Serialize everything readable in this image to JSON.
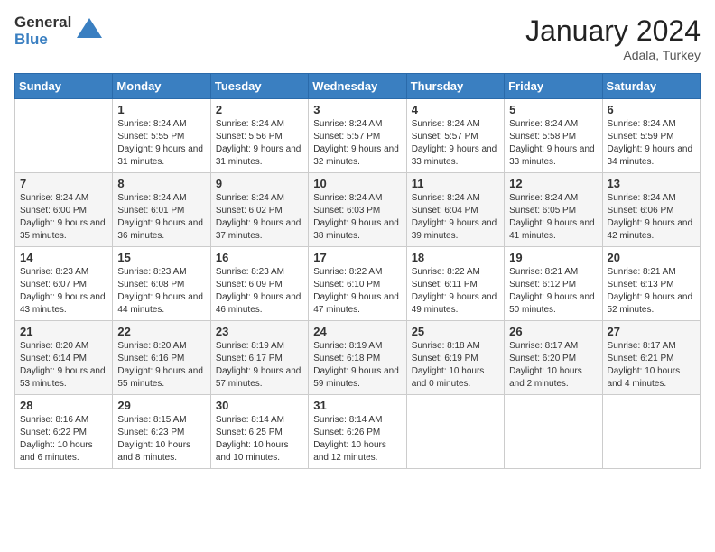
{
  "logo": {
    "general": "General",
    "blue": "Blue"
  },
  "header": {
    "month": "January 2024",
    "location": "Adala, Turkey"
  },
  "weekdays": [
    "Sunday",
    "Monday",
    "Tuesday",
    "Wednesday",
    "Thursday",
    "Friday",
    "Saturday"
  ],
  "weeks": [
    [
      {
        "day": "",
        "sunrise": "",
        "sunset": "",
        "daylight": ""
      },
      {
        "day": "1",
        "sunrise": "Sunrise: 8:24 AM",
        "sunset": "Sunset: 5:55 PM",
        "daylight": "Daylight: 9 hours and 31 minutes."
      },
      {
        "day": "2",
        "sunrise": "Sunrise: 8:24 AM",
        "sunset": "Sunset: 5:56 PM",
        "daylight": "Daylight: 9 hours and 31 minutes."
      },
      {
        "day": "3",
        "sunrise": "Sunrise: 8:24 AM",
        "sunset": "Sunset: 5:57 PM",
        "daylight": "Daylight: 9 hours and 32 minutes."
      },
      {
        "day": "4",
        "sunrise": "Sunrise: 8:24 AM",
        "sunset": "Sunset: 5:57 PM",
        "daylight": "Daylight: 9 hours and 33 minutes."
      },
      {
        "day": "5",
        "sunrise": "Sunrise: 8:24 AM",
        "sunset": "Sunset: 5:58 PM",
        "daylight": "Daylight: 9 hours and 33 minutes."
      },
      {
        "day": "6",
        "sunrise": "Sunrise: 8:24 AM",
        "sunset": "Sunset: 5:59 PM",
        "daylight": "Daylight: 9 hours and 34 minutes."
      }
    ],
    [
      {
        "day": "7",
        "sunrise": "Sunrise: 8:24 AM",
        "sunset": "Sunset: 6:00 PM",
        "daylight": "Daylight: 9 hours and 35 minutes."
      },
      {
        "day": "8",
        "sunrise": "Sunrise: 8:24 AM",
        "sunset": "Sunset: 6:01 PM",
        "daylight": "Daylight: 9 hours and 36 minutes."
      },
      {
        "day": "9",
        "sunrise": "Sunrise: 8:24 AM",
        "sunset": "Sunset: 6:02 PM",
        "daylight": "Daylight: 9 hours and 37 minutes."
      },
      {
        "day": "10",
        "sunrise": "Sunrise: 8:24 AM",
        "sunset": "Sunset: 6:03 PM",
        "daylight": "Daylight: 9 hours and 38 minutes."
      },
      {
        "day": "11",
        "sunrise": "Sunrise: 8:24 AM",
        "sunset": "Sunset: 6:04 PM",
        "daylight": "Daylight: 9 hours and 39 minutes."
      },
      {
        "day": "12",
        "sunrise": "Sunrise: 8:24 AM",
        "sunset": "Sunset: 6:05 PM",
        "daylight": "Daylight: 9 hours and 41 minutes."
      },
      {
        "day": "13",
        "sunrise": "Sunrise: 8:24 AM",
        "sunset": "Sunset: 6:06 PM",
        "daylight": "Daylight: 9 hours and 42 minutes."
      }
    ],
    [
      {
        "day": "14",
        "sunrise": "Sunrise: 8:23 AM",
        "sunset": "Sunset: 6:07 PM",
        "daylight": "Daylight: 9 hours and 43 minutes."
      },
      {
        "day": "15",
        "sunrise": "Sunrise: 8:23 AM",
        "sunset": "Sunset: 6:08 PM",
        "daylight": "Daylight: 9 hours and 44 minutes."
      },
      {
        "day": "16",
        "sunrise": "Sunrise: 8:23 AM",
        "sunset": "Sunset: 6:09 PM",
        "daylight": "Daylight: 9 hours and 46 minutes."
      },
      {
        "day": "17",
        "sunrise": "Sunrise: 8:22 AM",
        "sunset": "Sunset: 6:10 PM",
        "daylight": "Daylight: 9 hours and 47 minutes."
      },
      {
        "day": "18",
        "sunrise": "Sunrise: 8:22 AM",
        "sunset": "Sunset: 6:11 PM",
        "daylight": "Daylight: 9 hours and 49 minutes."
      },
      {
        "day": "19",
        "sunrise": "Sunrise: 8:21 AM",
        "sunset": "Sunset: 6:12 PM",
        "daylight": "Daylight: 9 hours and 50 minutes."
      },
      {
        "day": "20",
        "sunrise": "Sunrise: 8:21 AM",
        "sunset": "Sunset: 6:13 PM",
        "daylight": "Daylight: 9 hours and 52 minutes."
      }
    ],
    [
      {
        "day": "21",
        "sunrise": "Sunrise: 8:20 AM",
        "sunset": "Sunset: 6:14 PM",
        "daylight": "Daylight: 9 hours and 53 minutes."
      },
      {
        "day": "22",
        "sunrise": "Sunrise: 8:20 AM",
        "sunset": "Sunset: 6:16 PM",
        "daylight": "Daylight: 9 hours and 55 minutes."
      },
      {
        "day": "23",
        "sunrise": "Sunrise: 8:19 AM",
        "sunset": "Sunset: 6:17 PM",
        "daylight": "Daylight: 9 hours and 57 minutes."
      },
      {
        "day": "24",
        "sunrise": "Sunrise: 8:19 AM",
        "sunset": "Sunset: 6:18 PM",
        "daylight": "Daylight: 9 hours and 59 minutes."
      },
      {
        "day": "25",
        "sunrise": "Sunrise: 8:18 AM",
        "sunset": "Sunset: 6:19 PM",
        "daylight": "Daylight: 10 hours and 0 minutes."
      },
      {
        "day": "26",
        "sunrise": "Sunrise: 8:17 AM",
        "sunset": "Sunset: 6:20 PM",
        "daylight": "Daylight: 10 hours and 2 minutes."
      },
      {
        "day": "27",
        "sunrise": "Sunrise: 8:17 AM",
        "sunset": "Sunset: 6:21 PM",
        "daylight": "Daylight: 10 hours and 4 minutes."
      }
    ],
    [
      {
        "day": "28",
        "sunrise": "Sunrise: 8:16 AM",
        "sunset": "Sunset: 6:22 PM",
        "daylight": "Daylight: 10 hours and 6 minutes."
      },
      {
        "day": "29",
        "sunrise": "Sunrise: 8:15 AM",
        "sunset": "Sunset: 6:23 PM",
        "daylight": "Daylight: 10 hours and 8 minutes."
      },
      {
        "day": "30",
        "sunrise": "Sunrise: 8:14 AM",
        "sunset": "Sunset: 6:25 PM",
        "daylight": "Daylight: 10 hours and 10 minutes."
      },
      {
        "day": "31",
        "sunrise": "Sunrise: 8:14 AM",
        "sunset": "Sunset: 6:26 PM",
        "daylight": "Daylight: 10 hours and 12 minutes."
      },
      {
        "day": "",
        "sunrise": "",
        "sunset": "",
        "daylight": ""
      },
      {
        "day": "",
        "sunrise": "",
        "sunset": "",
        "daylight": ""
      },
      {
        "day": "",
        "sunrise": "",
        "sunset": "",
        "daylight": ""
      }
    ]
  ]
}
